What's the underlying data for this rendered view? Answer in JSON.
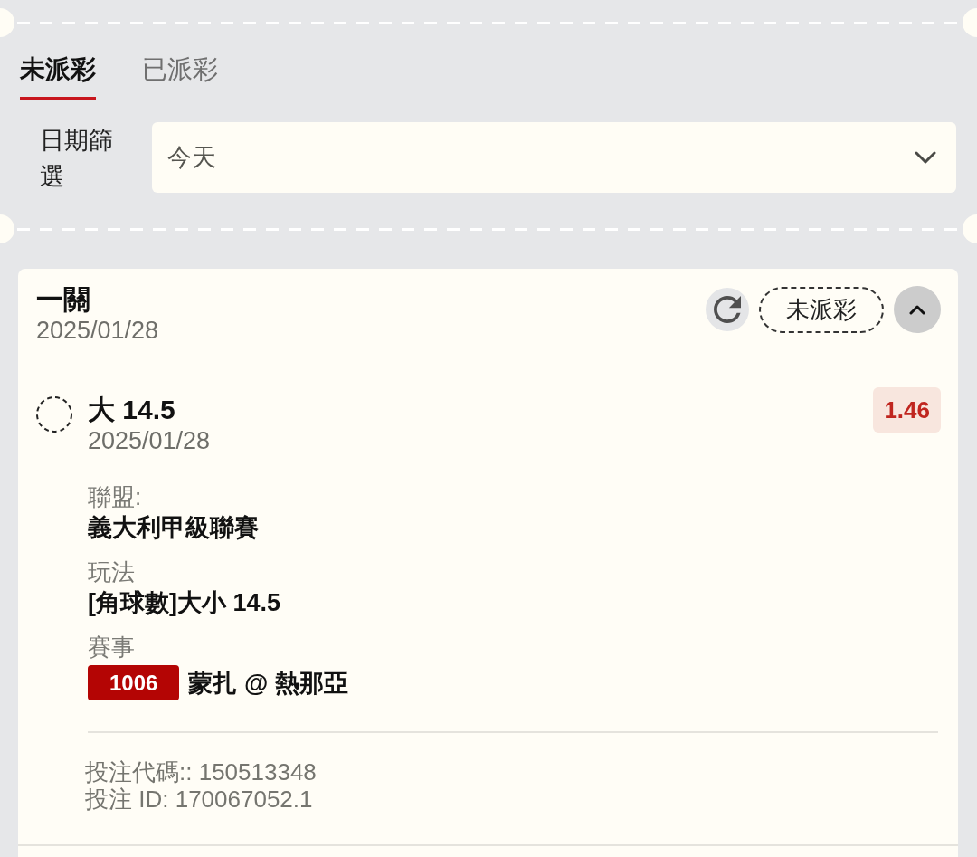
{
  "tabs": [
    {
      "label": "未派彩",
      "selected": true
    },
    {
      "label": "已派彩",
      "selected": false
    }
  ],
  "date_filter": {
    "label": "日期篩選",
    "value": "今天"
  },
  "bet_card": {
    "title": "一關",
    "date": "2025/01/28",
    "status": "未派彩",
    "expanded": true,
    "selection": {
      "name": "大 14.5",
      "date": "2025/01/28",
      "odds": "1.46",
      "details": [
        {
          "label": "聯盟:",
          "value": "義大利甲級聯賽"
        },
        {
          "label": "玩法",
          "value": "[角球數]大小 14.5"
        },
        {
          "label": "賽事",
          "match_number": "1006",
          "value": "蒙扎 @ 熱那亞"
        }
      ]
    },
    "bet_code": "投注代碼:: 150513348",
    "bet_id": "投注 ID: 170067052.1"
  }
}
